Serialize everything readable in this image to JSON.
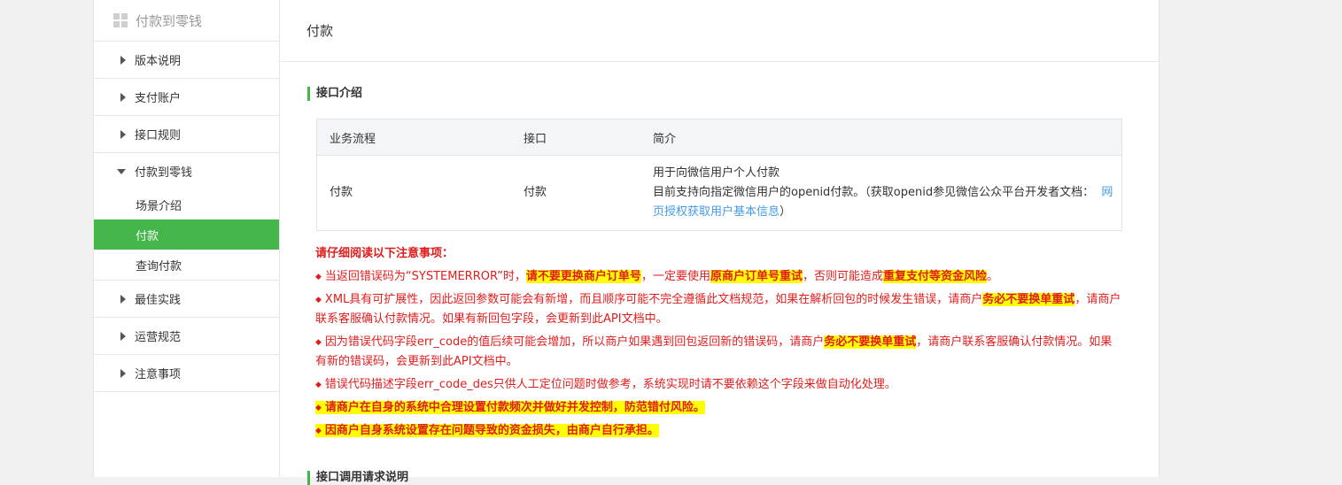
{
  "sidebar": {
    "header": "付款到零钱",
    "items": [
      {
        "label": "版本说明"
      },
      {
        "label": "支付账户"
      },
      {
        "label": "接口规则"
      }
    ],
    "open_group": {
      "label": "付款到零钱",
      "subitems": [
        {
          "label": "场景介绍"
        },
        {
          "label": "付款"
        },
        {
          "label": "查询付款"
        }
      ]
    },
    "items_after": [
      {
        "label": "最佳实践"
      },
      {
        "label": "运营规范"
      },
      {
        "label": "注意事项"
      }
    ]
  },
  "main": {
    "title": "付款",
    "section1": "接口介绍",
    "table": {
      "headers": [
        "业务流程",
        "接口",
        "简介"
      ],
      "row": {
        "flow": "付款",
        "api": "付款",
        "desc_line1": "用于向微信用户个人付款",
        "desc_line2": "目前支持向指定微信用户的openid付款。（获取openid参见微信公众平台开发者文档：",
        "desc_link": "网页授权获取用户基本信息",
        "desc_tail": "）"
      }
    },
    "notes": {
      "head": "请仔细阅读以下注意事项：",
      "n1": [
        "当返回错误码为“SYSTEMERROR”时，",
        "请不要更换商户订单号",
        "，一定要使用",
        "原商户订单号重试",
        "，否则可能造成",
        "重复支付等资金风险",
        "。"
      ],
      "n2": [
        "XML具有可扩展性，因此返回参数可能会有新增，而且顺序可能不完全遵循此文档规范，如果在解析回包的时候发生错误，请商户",
        "务必不要换单重试",
        "，请商户联系客服确认付款情况。如果有新回包字段，会更新到此API文档中。"
      ],
      "n3": [
        "因为错误代码字段err_code的值后续可能会增加，所以商户如果遇到回包返回新的错误码，请商户",
        "务必不要换单重试",
        "，请商户联系客服确认付款情况。如果有新的错误码，会更新到此API文档中。"
      ],
      "n4": "错误代码描述字段err_code_des只供人工定位问题时做参考，系统实现时请不要依赖这个字段来做自动化处理。",
      "n5": "请商户在自身的系统中合理设置付款频次并做好并发控制，防范错付风险。",
      "n6": "因商户自身系统设置存在问题导致的资金损失，由商户自行承担。"
    },
    "section2": "接口调用请求说明"
  },
  "colors": {
    "accent": "#44b549",
    "warning": "#e01d1d",
    "highlight": "#ffff00",
    "link": "#459ae9"
  },
  "icons": {
    "header": "grid-icon",
    "collapsed": "caret-right-icon",
    "expanded": "caret-down-icon",
    "bullet": "diamond-bullet-icon"
  }
}
